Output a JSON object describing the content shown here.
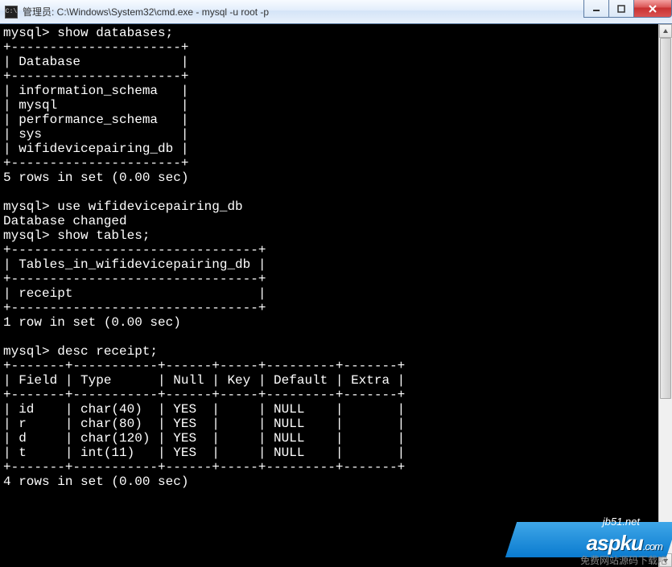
{
  "window": {
    "title": "管理员: C:\\Windows\\System32\\cmd.exe - mysql  -u root -p",
    "icon_label": "C:\\"
  },
  "terminal": {
    "prompt": "mysql>",
    "cmd_show_databases": "show databases;",
    "db_header": "Database",
    "databases": [
      "information_schema",
      "mysql",
      "performance_schema",
      "sys",
      "wifidevicepairing_db"
    ],
    "db_rows_msg": "5 rows in set (0.00 sec)",
    "cmd_use": "use wifidevicepairing_db",
    "db_changed": "Database changed",
    "cmd_show_tables": "show tables;",
    "tables_header": "Tables_in_wifidevicepairing_db",
    "tables": [
      "receipt"
    ],
    "tables_rows_msg": "1 row in set (0.00 sec)",
    "cmd_desc": "desc receipt;",
    "desc_cols": [
      "Field",
      "Type",
      "Null",
      "Key",
      "Default",
      "Extra"
    ],
    "desc_rows": [
      {
        "field": "id",
        "type": "char(40)",
        "null": "YES",
        "key": "",
        "default": "NULL",
        "extra": ""
      },
      {
        "field": "r",
        "type": "char(80)",
        "null": "YES",
        "key": "",
        "default": "NULL",
        "extra": ""
      },
      {
        "field": "d",
        "type": "char(120)",
        "null": "YES",
        "key": "",
        "default": "NULL",
        "extra": ""
      },
      {
        "field": "t",
        "type": "int(11)",
        "null": "YES",
        "key": "",
        "default": "NULL",
        "extra": ""
      }
    ],
    "desc_rows_msg": "4 rows in set (0.00 sec)"
  },
  "watermark": {
    "site1": "jb51.net",
    "brand": "aspku",
    "tld": ".com",
    "sub": "免费网站源码下载吧"
  }
}
